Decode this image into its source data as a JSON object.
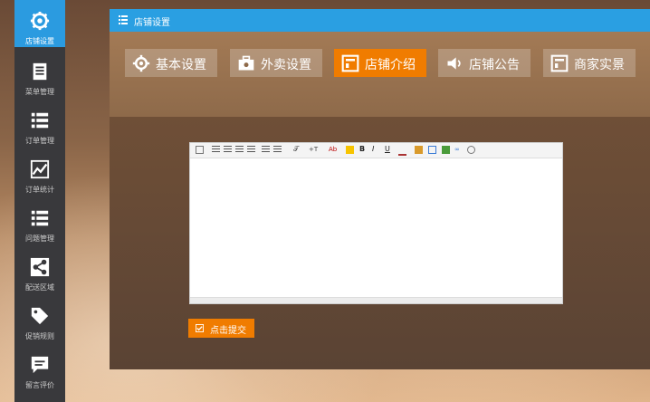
{
  "sidebar": {
    "items": [
      {
        "label": "店铺设置",
        "icon": "gear-icon",
        "active": true
      },
      {
        "label": "菜单管理",
        "icon": "document-icon"
      },
      {
        "label": "订单管理",
        "icon": "list-icon"
      },
      {
        "label": "订单统计",
        "icon": "chart-icon"
      },
      {
        "label": "问题管理",
        "icon": "list-icon"
      },
      {
        "label": "配送区域",
        "icon": "share-icon"
      },
      {
        "label": "促销规则",
        "icon": "tag-icon"
      },
      {
        "label": "留言评价",
        "icon": "comment-icon"
      }
    ]
  },
  "header": {
    "title": "店铺设置",
    "icon": "list-icon"
  },
  "tabs": [
    {
      "label": "基本设置",
      "icon": "gear-icon"
    },
    {
      "label": "外卖设置",
      "icon": "toolbox-icon"
    },
    {
      "label": "店铺介绍",
      "icon": "window-icon",
      "active": true
    },
    {
      "label": "店铺公告",
      "icon": "speaker-icon"
    },
    {
      "label": "商家实景",
      "icon": "window-icon"
    }
  ],
  "editor": {
    "content": ""
  },
  "submit": {
    "label": "点击提交",
    "icon": "checkbox-icon"
  },
  "colors": {
    "accent": "#f07c00",
    "titlebar": "#2a9fe2",
    "sidebar": "#39393c",
    "sidebar_active": "#2b9be0"
  }
}
